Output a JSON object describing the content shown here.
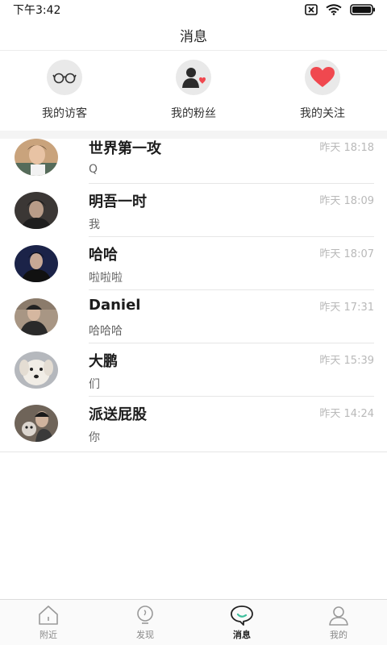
{
  "status": {
    "time": "下午3:42"
  },
  "header": {
    "title": "消息"
  },
  "shortcuts": [
    {
      "label": "我的访客",
      "icon": "glasses-icon"
    },
    {
      "label": "我的粉丝",
      "icon": "fans-icon"
    },
    {
      "label": "我的关注",
      "icon": "heart-icon"
    }
  ],
  "conversations": [
    {
      "name": "世界第一攻",
      "time": "昨天 18:18",
      "message": "Q"
    },
    {
      "name": "明吾一时",
      "time": "昨天 18:09",
      "message": "我"
    },
    {
      "name": "哈哈",
      "time": "昨天 18:07",
      "message": "啦啦啦"
    },
    {
      "name": "Daniel",
      "time": "昨天 17:31",
      "message": "哈哈哈"
    },
    {
      "name": "大鹏",
      "time": "昨天 15:39",
      "message": "们"
    },
    {
      "name": "派送屁股",
      "time": "昨天 14:24",
      "message": "你"
    }
  ],
  "tabs": [
    {
      "label": "附近",
      "icon": "home-icon",
      "active": false
    },
    {
      "label": "发现",
      "icon": "bulb-icon",
      "active": false
    },
    {
      "label": "消息",
      "icon": "chat-bubble-icon",
      "active": true
    },
    {
      "label": "我的",
      "icon": "profile-icon",
      "active": false
    }
  ],
  "colors": {
    "accent": "#3dbf9c",
    "heart": "#f0484f"
  }
}
